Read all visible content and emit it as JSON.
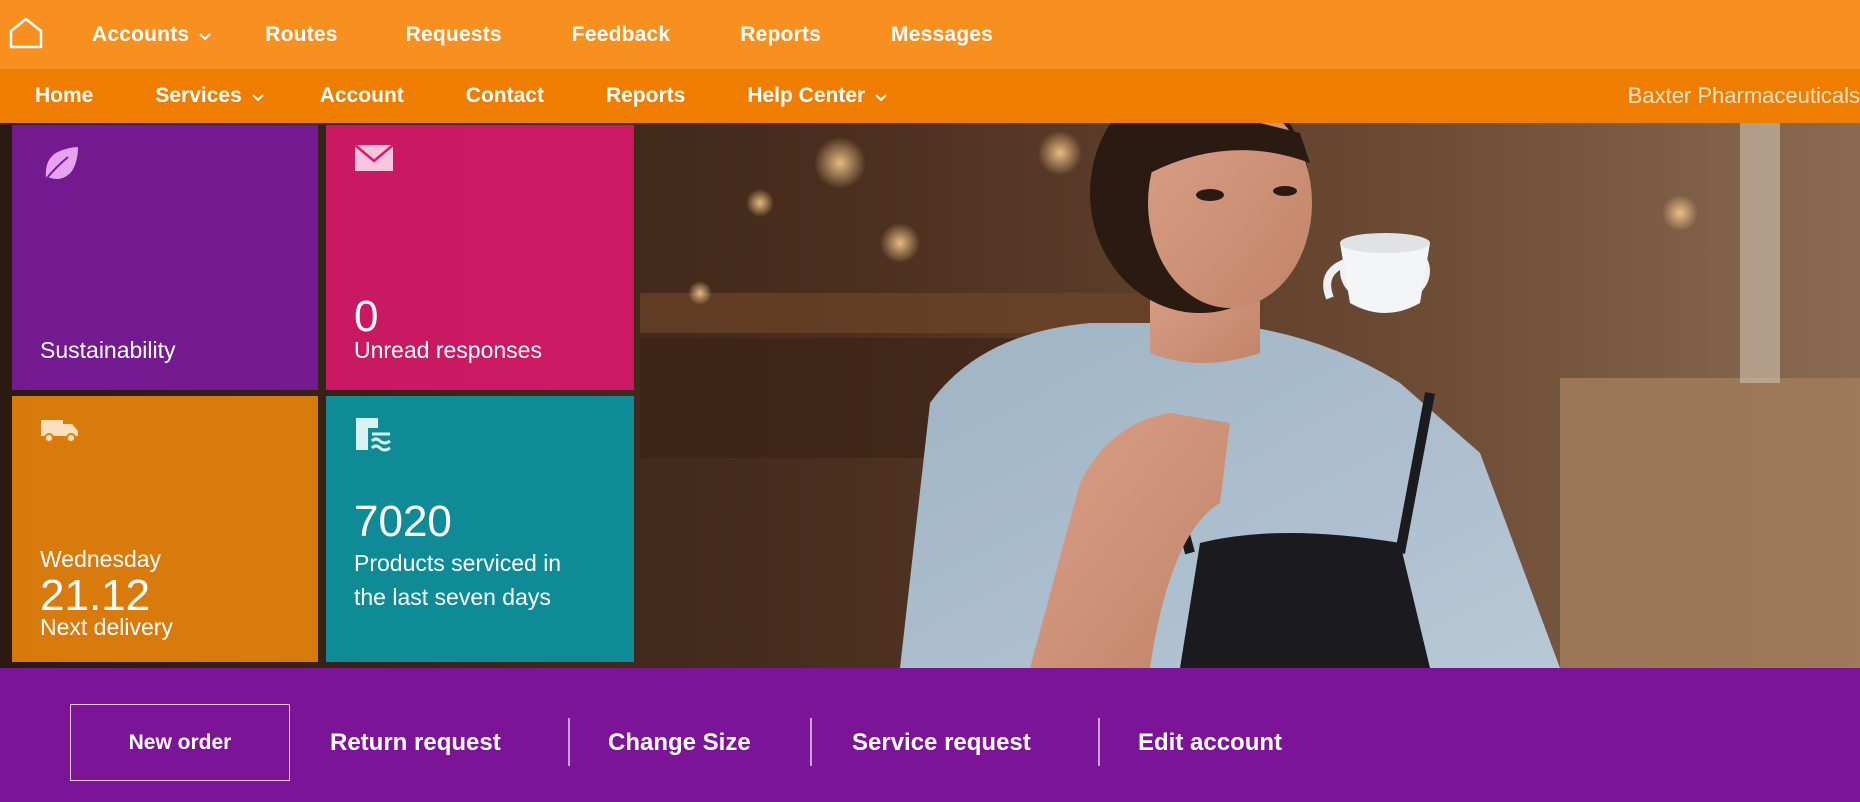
{
  "topnav": {
    "items": [
      {
        "label": "Accounts",
        "dropdown": true
      },
      {
        "label": "Routes"
      },
      {
        "label": "Requests"
      },
      {
        "label": "Feedback"
      },
      {
        "label": "Reports"
      },
      {
        "label": "Messages"
      }
    ]
  },
  "subnav": {
    "items": [
      {
        "label": "Home"
      },
      {
        "label": "Services",
        "dropdown": true
      },
      {
        "label": "Account"
      },
      {
        "label": "Contact"
      },
      {
        "label": "Reports"
      },
      {
        "label": "Help Center",
        "dropdown": true
      }
    ],
    "brand": "Baxter Pharmaceuticals"
  },
  "tiles": {
    "sustainability": {
      "label": "Sustainability",
      "icon": "leaf-icon"
    },
    "unread": {
      "count": "0",
      "label": "Unread responses",
      "icon": "envelope-icon"
    },
    "delivery": {
      "day": "Wednesday",
      "date": "21.12",
      "label": "Next delivery",
      "icon": "truck-icon"
    },
    "products": {
      "count": "7020",
      "label_line1": "Products serviced in",
      "label_line2": "the last seven days",
      "icon": "clipboard-icon"
    }
  },
  "actions": {
    "new_order": "New order",
    "return_request": "Return request",
    "change_size": "Change Size",
    "service_request": "Service request",
    "edit_account": "Edit account"
  },
  "colors": {
    "top_bar": "#f7901e",
    "sub_bar": "#ef7d00",
    "sustainability_tile": "#7a1a9c",
    "unread_tile": "#da186c",
    "delivery_tile": "#e2800c",
    "products_tile": "#0e909c",
    "action_bar": "#7b1496"
  }
}
